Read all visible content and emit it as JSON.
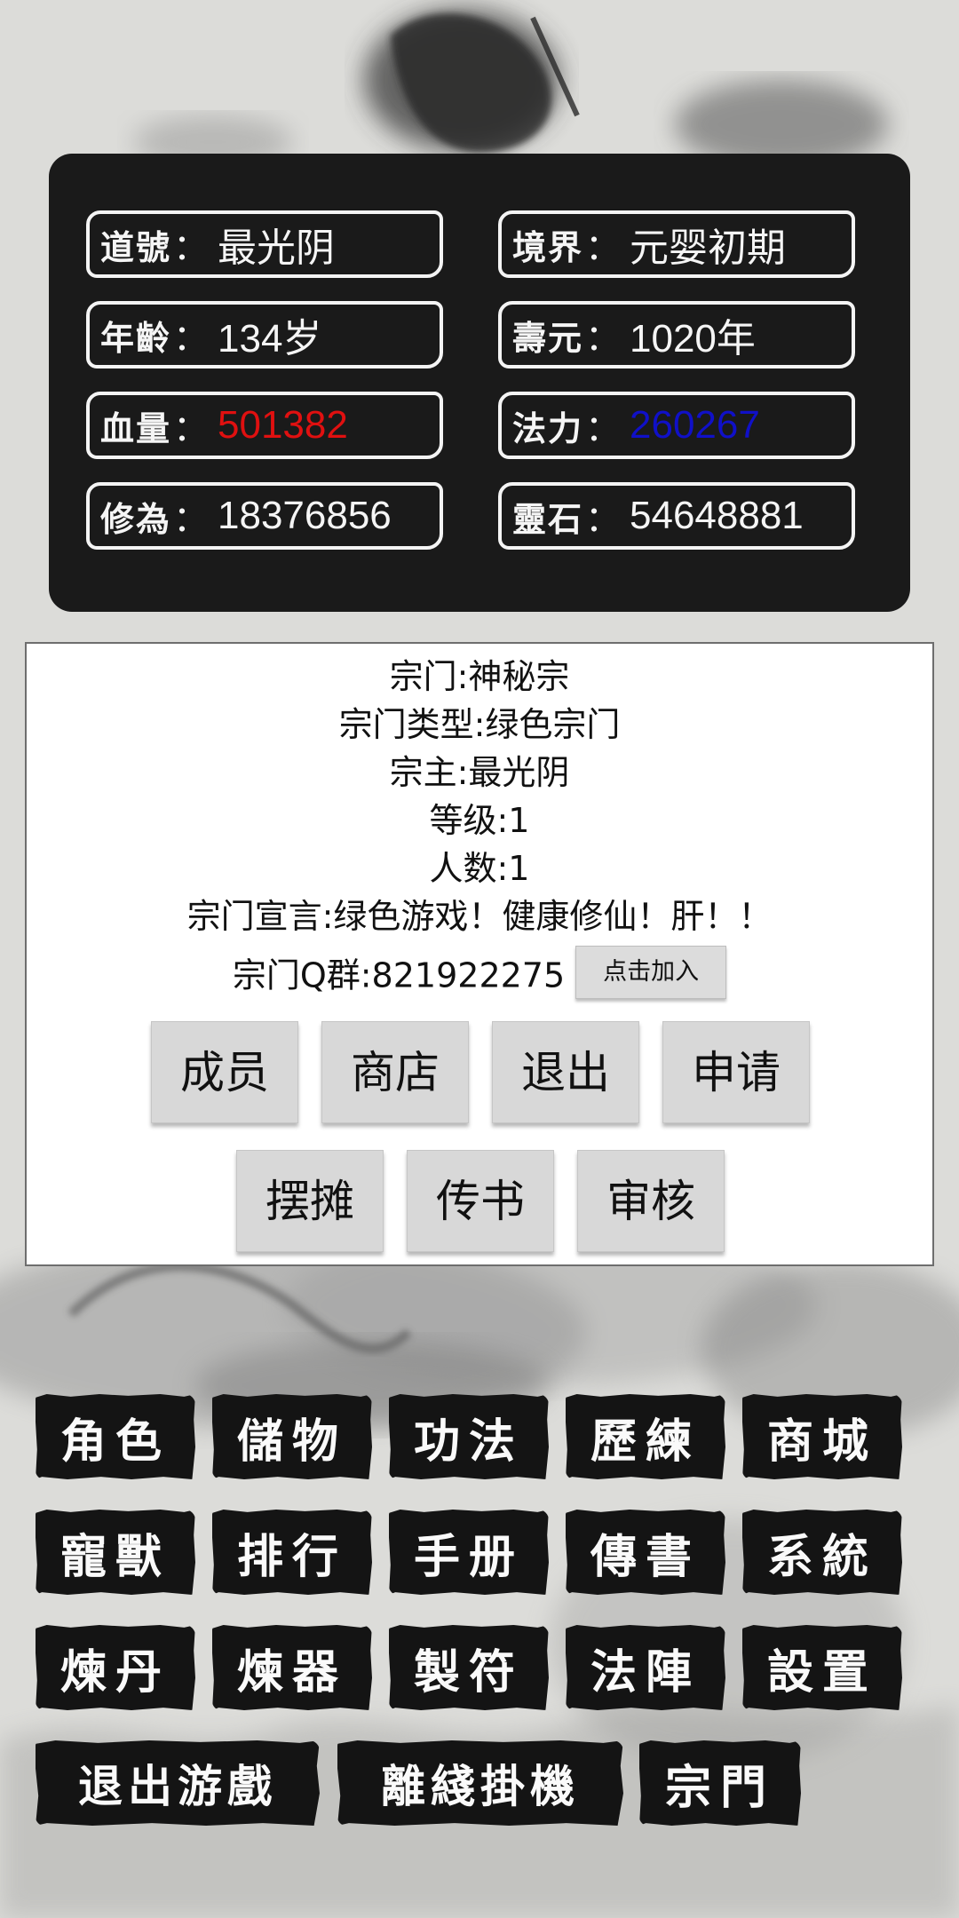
{
  "stats": [
    {
      "label": "道號",
      "value": "最光阴",
      "color": "normal"
    },
    {
      "label": "境界",
      "value": "元婴初期",
      "color": "normal"
    },
    {
      "label": "年齡",
      "value": "134岁",
      "color": "normal"
    },
    {
      "label": "壽元",
      "value": "1020年",
      "color": "normal"
    },
    {
      "label": "血量",
      "value": "501382",
      "color": "red"
    },
    {
      "label": "法力",
      "value": "260267",
      "color": "blue"
    },
    {
      "label": "修為",
      "value": "18376856",
      "color": "normal"
    },
    {
      "label": "靈石",
      "value": "54648881",
      "color": "normal"
    }
  ],
  "colon": "：",
  "sect": {
    "name": "宗门:神秘宗",
    "type": "宗门类型:绿色宗门",
    "leader": "宗主:最光阴",
    "level": "等级:1",
    "members": "人数:1",
    "declaration": "宗门宣言:绿色游戏！健康修仙！肝！！",
    "qq_group": "宗门Q群:821922275",
    "join_button": "点击加入",
    "buttons_row1": [
      "成员",
      "商店",
      "退出",
      "申请"
    ],
    "buttons_row2": [
      "摆摊",
      "传书",
      "审核"
    ]
  },
  "menu": {
    "row1": [
      "角色",
      "儲物",
      "功法",
      "歷練",
      "商城"
    ],
    "row2": [
      "寵獸",
      "排行",
      "手册",
      "傳書",
      "系統"
    ],
    "row3": [
      "煉丹",
      "煉器",
      "製符",
      "法陣",
      "設置"
    ],
    "row4": [
      "退出游戲",
      "離綫掛機",
      "宗門"
    ]
  },
  "colors": {
    "hp": "#e01010",
    "mp": "#1010c8",
    "panel": "#1a1a1a"
  }
}
